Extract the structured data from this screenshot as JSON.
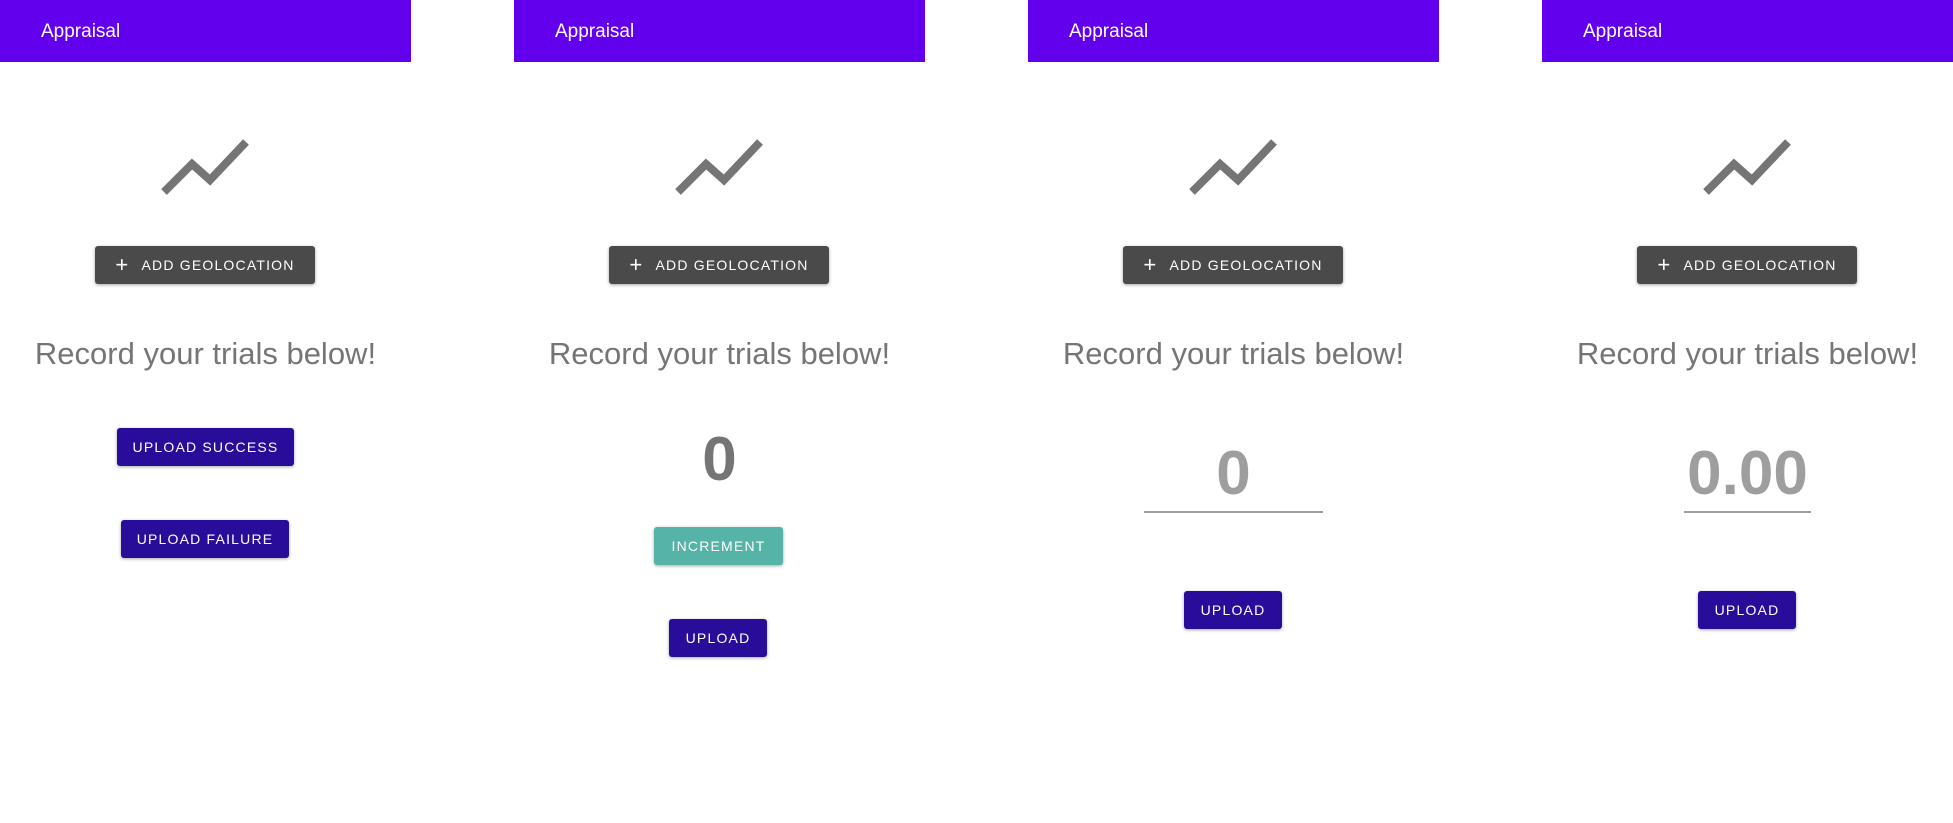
{
  "colors": {
    "app_bar": "#6200ee",
    "geo_button": "#4a4a4a",
    "primary_button": "#2a0c9a",
    "increment_button": "#55b3a7",
    "muted_text": "#757575"
  },
  "screens": [
    {
      "title": "Appraisal",
      "icon": "trending-up-icon",
      "geo_button_label": "ADD GEOLOCATION",
      "heading": "Record your trials below!",
      "upload_success_label": "UPLOAD SUCCESS",
      "upload_failure_label": "UPLOAD FAILURE"
    },
    {
      "title": "Appraisal",
      "icon": "trending-up-icon",
      "geo_button_label": "ADD GEOLOCATION",
      "heading": "Record your trials below!",
      "count_value": "0",
      "increment_label": "INCREMENT",
      "upload_label": "UPLOAD"
    },
    {
      "title": "Appraisal",
      "icon": "trending-up-icon",
      "geo_button_label": "ADD GEOLOCATION",
      "heading": "Record your trials below!",
      "input_placeholder": "0",
      "upload_label": "UPLOAD"
    },
    {
      "title": "Appraisal",
      "icon": "trending-up-icon",
      "geo_button_label": "ADD GEOLOCATION",
      "heading": "Record your trials below!",
      "input_placeholder": "0.00",
      "upload_label": "UPLOAD"
    }
  ]
}
